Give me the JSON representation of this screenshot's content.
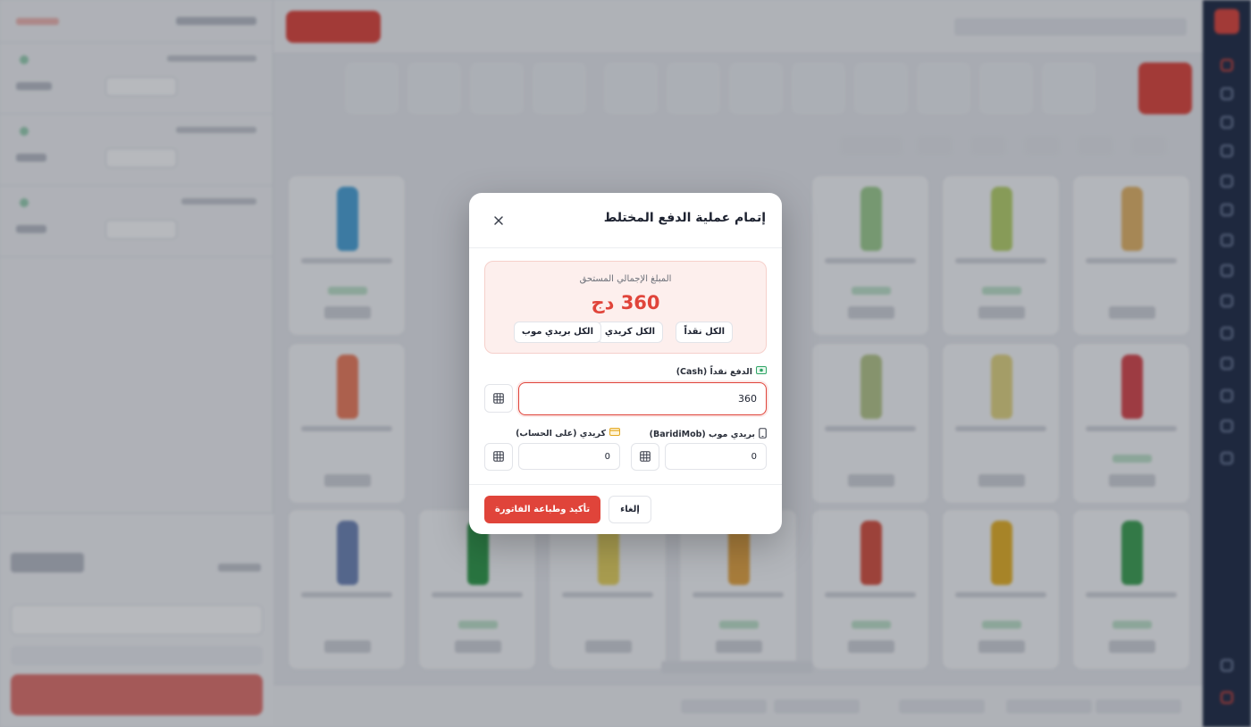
{
  "modal": {
    "title": "إتمام عملية الدفع المختلط",
    "due_label": "المبلغ الإجمالي المستحق",
    "due_amount": "360 دج",
    "quick_buttons": {
      "all_cash": "الكل نقداً",
      "all_credit": "الكل كريدي",
      "all_baridimob": "الكل بريدي موب"
    },
    "cash": {
      "label": "الدفع نقداً (Cash)",
      "value": "360"
    },
    "baridimob": {
      "label": "بريدي موب (BaridiMob)",
      "value": "0"
    },
    "credit": {
      "label": "كريدي (على الحساب)",
      "value": "0"
    },
    "cancel_label": "إلغاء",
    "confirm_label": "تأكيد وطباعة الفاتورة"
  },
  "colors": {
    "accent": "#e0443a",
    "due_bg": "#fdefed",
    "rail": "#1e2a44"
  },
  "icons": {
    "close": "close-icon",
    "cash": "cash-icon",
    "credit": "credit-card-icon",
    "baridimob": "mobile-phone-icon",
    "calculator": "calculator-icon"
  }
}
